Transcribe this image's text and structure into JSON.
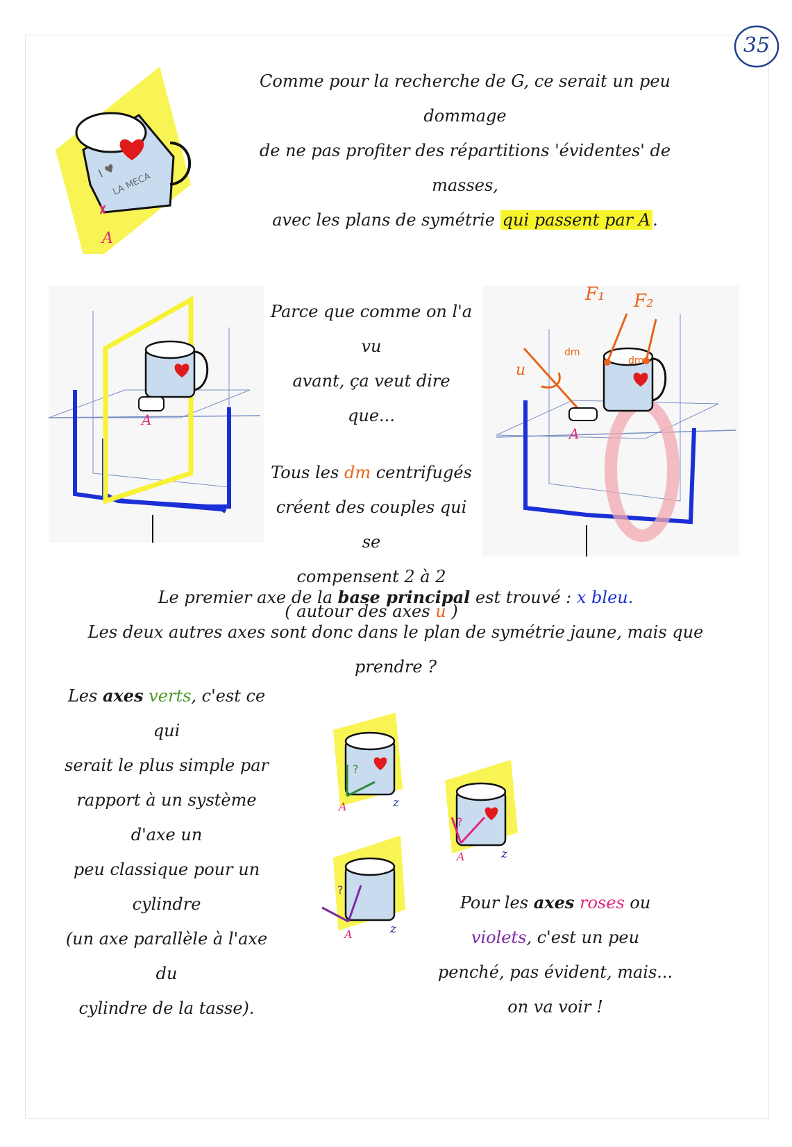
{
  "page_number": "35",
  "intro": {
    "line1": "Comme pour la recherche de G, ce serait un peu dommage",
    "line2": "de ne pas profiter des répartitions 'évidentes' de masses,",
    "line3_start": "avec les plans de symétrie",
    "line3_highlight": "qui passent par A",
    "line3_end": "."
  },
  "middle": {
    "line1": "Parce que comme on l'a vu",
    "line2": "avant, ça veut dire que...",
    "line3_start": "Tous les",
    "line3_dm": "dm",
    "line3_end": "centrifugés",
    "line4": "créent des couples qui se",
    "line5": "compensent 2 à 2",
    "line6_start": "( autour des axes",
    "line6_u": "u",
    "line6_end": ")"
  },
  "conclusion": {
    "line1_start": "Le premier axe de la",
    "line1_bold": "base principal",
    "line1_mid": "est trouvé :",
    "line1_blue": "x bleu.",
    "line2": "Les deux autres axes sont donc dans le plan de symétrie jaune, mais que prendre ?"
  },
  "green_note": {
    "line1_start": "Les",
    "line1_bold": "axes",
    "line1_green": "verts",
    "line1_end": ", c'est ce qui",
    "line2": "serait le plus simple par",
    "line3": "rapport à un système d'axe un",
    "line4": "peu classique pour un cylindre",
    "line5": "(un axe parallèle à l'axe du",
    "line6": "cylindre de la tasse)."
  },
  "pink_note": {
    "line1_start": "Pour les",
    "line1_bold": "axes",
    "line1_pink": "roses",
    "line1_end": "ou",
    "line2_violet": "violets",
    "line2_end": ", c'est un peu",
    "line3": "penché, pas évident, mais...",
    "line4": "on va voir !"
  },
  "labels": {
    "point_a": "A",
    "f1": "F₁",
    "f2": "F₂",
    "dm": "dm",
    "u": "u",
    "question": "?",
    "z": "z",
    "mug_text": "I ♥ LA MECA"
  },
  "colors": {
    "yellow_plane": "#f7f235",
    "blue_frame": "#1b2fd6",
    "orange": "#e8641b",
    "pink": "#e0287a",
    "violet": "#7a2aa0",
    "green": "#2e8a3a",
    "mug_red": "#e11b1b",
    "grid": "#7a8fc8"
  }
}
